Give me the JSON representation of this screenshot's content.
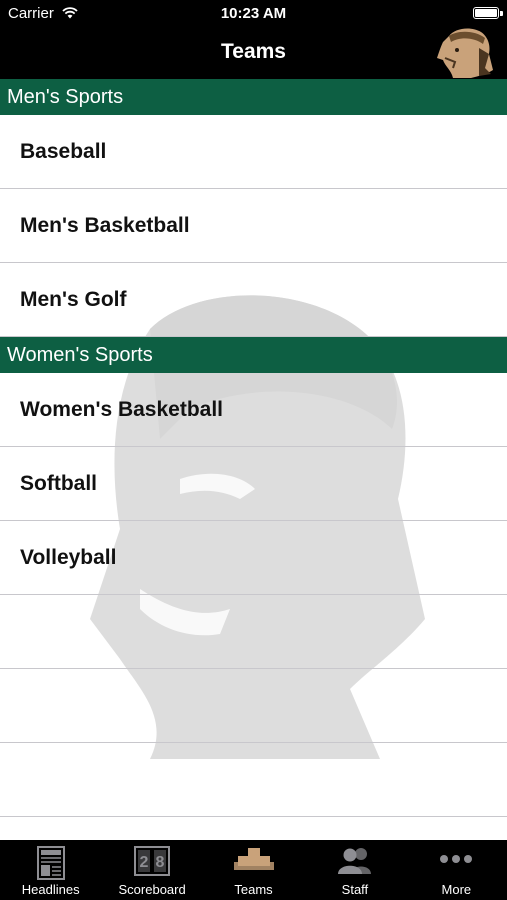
{
  "status": {
    "carrier": "Carrier",
    "time": "10:23 AM",
    "battery_level": 1.0
  },
  "navbar": {
    "title": "Teams",
    "logo_icon": "warrior-head-logo"
  },
  "sections": [
    {
      "title": "Men's Sports",
      "teams": [
        "Baseball",
        "Men's Basketball",
        "Men's Golf"
      ]
    },
    {
      "title": "Women's Sports",
      "teams": [
        "Women's Basketball",
        "Softball",
        "Volleyball"
      ]
    }
  ],
  "tabs": [
    {
      "label": "Headlines",
      "icon": "newspaper-icon",
      "active": false
    },
    {
      "label": "Scoreboard",
      "icon": "scoreboard-icon",
      "active": false
    },
    {
      "label": "Teams",
      "icon": "teams-icon",
      "active": true
    },
    {
      "label": "Staff",
      "icon": "staff-icon",
      "active": false
    },
    {
      "label": "More",
      "icon": "more-icon",
      "active": false
    }
  ],
  "colors": {
    "section_header": "#0d5f43",
    "tab_active": "#c9a27a",
    "tab_inactive": "#8e8e93"
  }
}
